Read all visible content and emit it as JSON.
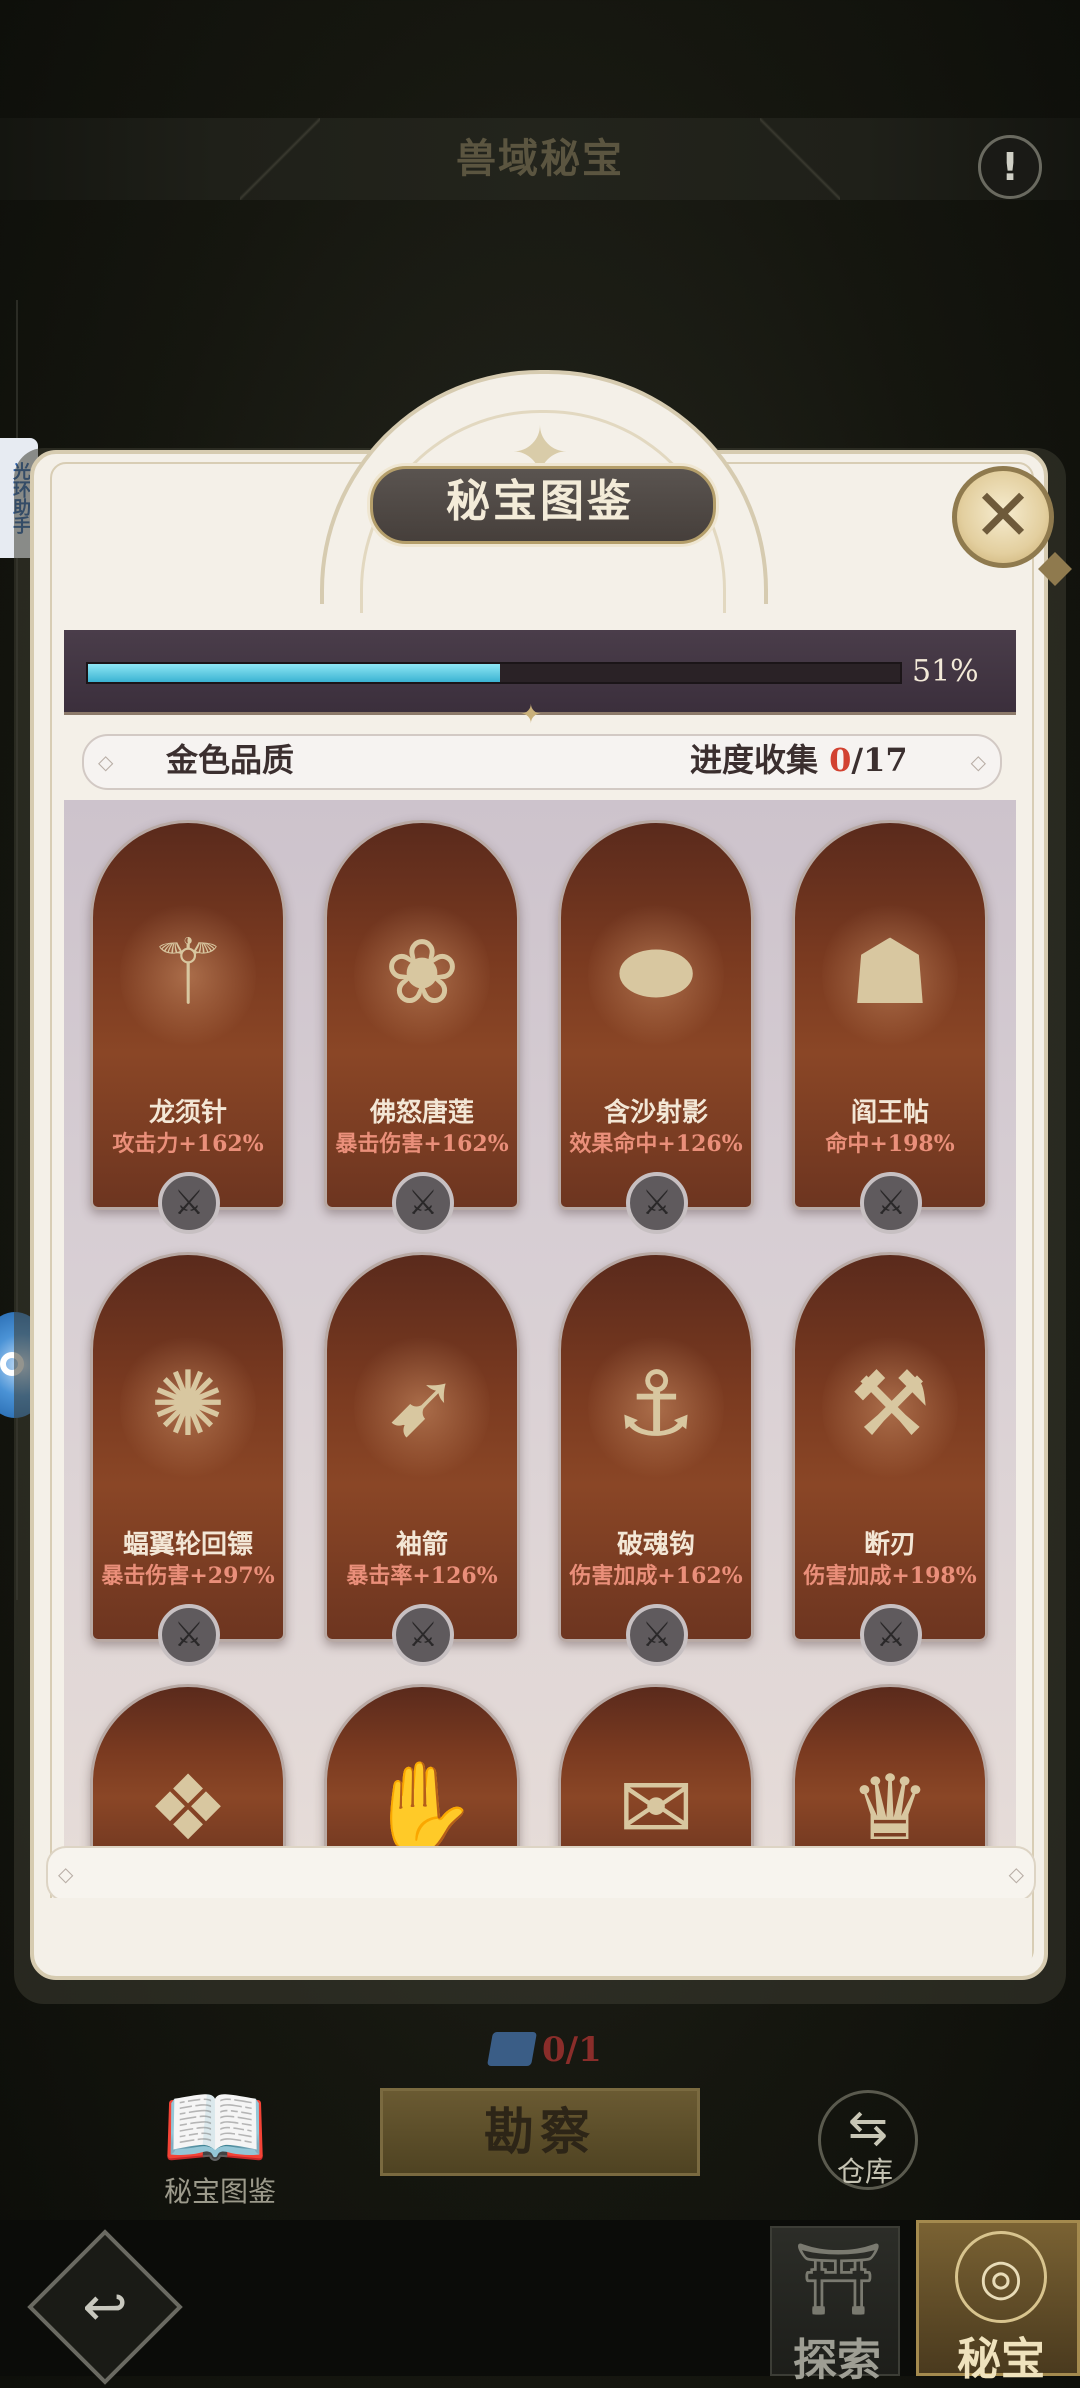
{
  "header": {
    "title": "兽域秘宝",
    "info_icon": "exclamation-icon"
  },
  "helper": {
    "label": "光环助手"
  },
  "modal": {
    "title": "秘宝图鉴",
    "close_icon": "close-icon",
    "overall_progress": {
      "percent_text": "51%",
      "fraction": 0.51
    },
    "quality": {
      "label": "金色品质",
      "collect_label": "进度收集",
      "collected": "0",
      "total_suffix": "/17"
    },
    "items": [
      {
        "name": "龙须针",
        "stat": "攻击力+162%",
        "icon": "dragon-needle-icon"
      },
      {
        "name": "佛怒唐莲",
        "stat": "暴击伤害+162%",
        "icon": "lotus-icon"
      },
      {
        "name": "含沙射影",
        "stat": "效果命中+126%",
        "icon": "arm-launcher-icon"
      },
      {
        "name": "阎王帖",
        "stat": "命中+198%",
        "icon": "demon-mask-icon"
      },
      {
        "name": "蝠翼轮回镖",
        "stat": "暴击伤害+297%",
        "icon": "bat-dart-icon"
      },
      {
        "name": "袖箭",
        "stat": "暴击率+126%",
        "icon": "sleeve-arrow-icon"
      },
      {
        "name": "破魂钩",
        "stat": "伤害加成+162%",
        "icon": "soul-hook-icon"
      },
      {
        "name": "断刃",
        "stat": "伤害加成+198%",
        "icon": "broken-blade-icon"
      },
      {
        "name": "",
        "stat": "",
        "icon": "golden-relic-icon"
      },
      {
        "name": "",
        "stat": "",
        "icon": "gauntlet-icon"
      },
      {
        "name": "",
        "stat": "",
        "icon": "scroll-icon"
      },
      {
        "name": "",
        "stat": "",
        "icon": "crown-icon"
      }
    ]
  },
  "bottom": {
    "ticket_count": "0/1",
    "survey_button": "勘察",
    "gallery_label": "秘宝图鉴",
    "warehouse_label": "仓库",
    "nav": {
      "explore": "探索",
      "treasure": "秘宝"
    }
  },
  "colors": {
    "progress": "#3bb3d2",
    "highlight": "#d24231",
    "stat_text": "#ea8f7a"
  }
}
